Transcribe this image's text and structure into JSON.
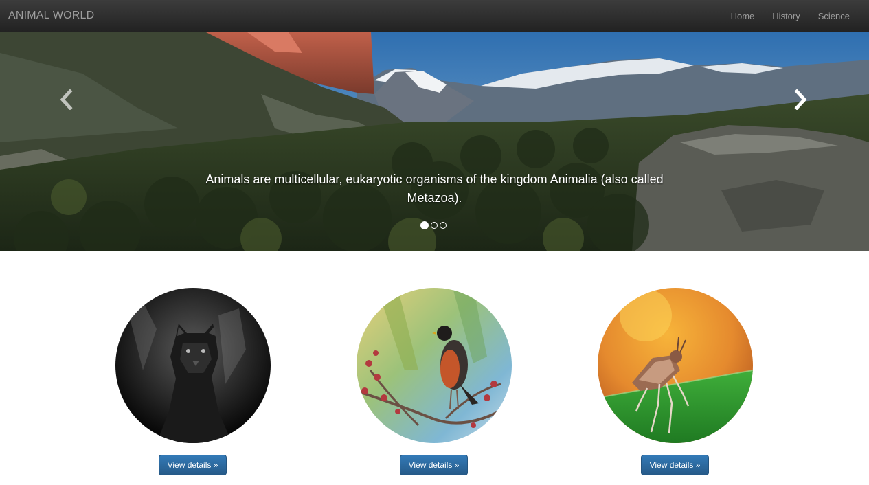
{
  "navbar": {
    "brand": "ANIMAL WORLD",
    "links": [
      "Home",
      "History",
      "Science"
    ]
  },
  "carousel": {
    "caption": "Animals are multicellular, eukaryotic organisms of the kingdom Animalia (also called Metazoa).",
    "prev_icon": "chevron-left-icon",
    "next_icon": "chevron-right-icon",
    "slide_count": 3,
    "active_slide": 1
  },
  "features": [
    {
      "image": "panther-photo",
      "button_label": "View details »"
    },
    {
      "image": "robin-bird-photo",
      "button_label": "View details »"
    },
    {
      "image": "stink-bug-photo",
      "button_label": "View details »"
    }
  ],
  "colors": {
    "navbar_bg": "#222222",
    "navbar_text": "#9d9d9d",
    "button_primary": "#337ab7"
  }
}
